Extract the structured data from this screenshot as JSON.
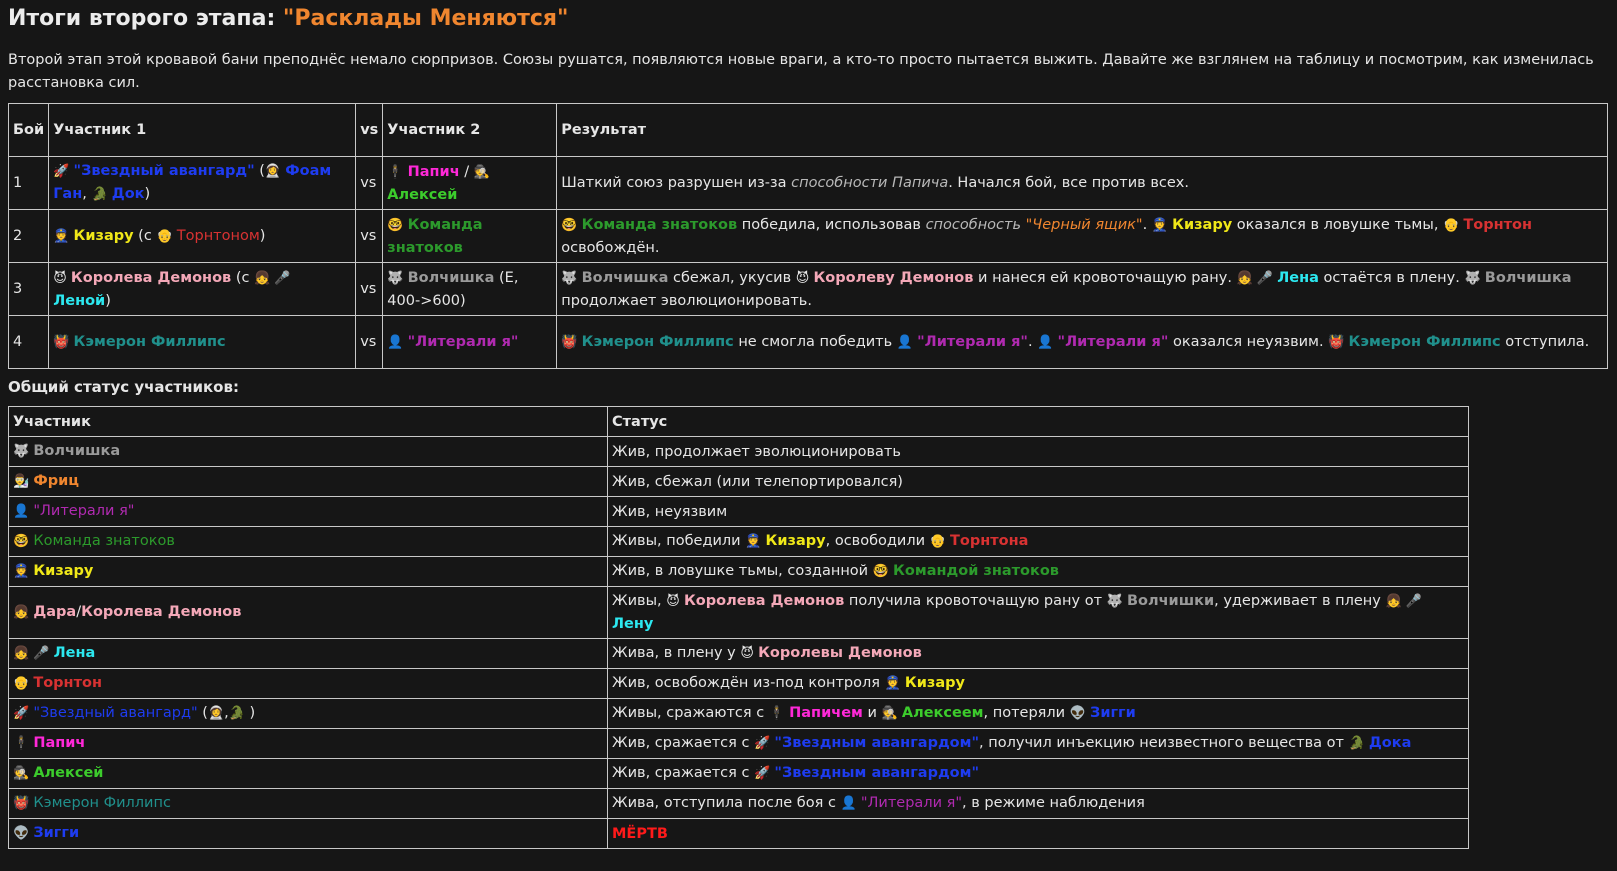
{
  "heading": {
    "prefix": "Итоги второго этапа: ",
    "accent": "\"Расклады Меняются\""
  },
  "intro": "Второй этап этой кровавой бани преподнёс немало сюрпризов. Союзы рушатся, появляются новые враги, а кто-то просто пытается выжить. Давайте же взглянем на таблицу и посмотрим, как изменилась расстановка сил.",
  "battles": {
    "headers": [
      "Бой",
      "Участник 1",
      "vs",
      "Участник 2",
      "Результат"
    ],
    "rows": [
      {
        "n": "1",
        "vs": "vs",
        "p1": [
          [
            "e",
            "🚀 "
          ],
          [
            "b blue",
            "\"Звездный авангард\""
          ],
          [
            "t",
            " ("
          ],
          [
            "e",
            "👩‍🚀 "
          ],
          [
            "b blue",
            "Фоам Ган"
          ],
          [
            "t",
            ", "
          ],
          [
            "e",
            "🐊 "
          ],
          [
            "b blue",
            "Док"
          ],
          [
            "t",
            ")"
          ]
        ],
        "p2": [
          [
            "e",
            "🕴 "
          ],
          [
            "b mag",
            "Папич"
          ],
          [
            "t",
            " / "
          ],
          [
            "e",
            "🕵 "
          ],
          [
            "b lime",
            "Алексей"
          ]
        ],
        "res": [
          [
            "t",
            "Шаткий союз разрушен из-за "
          ],
          [
            "i",
            "способности Папича"
          ],
          [
            "t",
            ". Начался бой, все против всех."
          ]
        ]
      },
      {
        "n": "2",
        "vs": "vs",
        "p1": [
          [
            "e",
            "👮 "
          ],
          [
            "b yel",
            "Кизару"
          ],
          [
            "t",
            " (с "
          ],
          [
            "e",
            "👴 "
          ],
          [
            "t red",
            "Торнтоном"
          ],
          [
            "t",
            ")"
          ]
        ],
        "p2": [
          [
            "e",
            "🤓 "
          ],
          [
            "b green",
            "Команда знатоков"
          ]
        ],
        "res": [
          [
            "e",
            "🤓 "
          ],
          [
            "b green",
            "Команда знатоков"
          ],
          [
            "t",
            " победила, использовав "
          ],
          [
            "i",
            "способность "
          ],
          [
            "oi",
            "\"Черный ящик\""
          ],
          [
            "t",
            ". "
          ],
          [
            "e",
            "👮 "
          ],
          [
            "b yel",
            "Кизару"
          ],
          [
            "t",
            " оказался в ловушке тьмы, "
          ],
          [
            "e",
            "👴 "
          ],
          [
            "b red",
            "Торнтон"
          ],
          [
            "t",
            " освобождён."
          ]
        ]
      },
      {
        "n": "3",
        "vs": "vs",
        "p1": [
          [
            "e",
            "😈 "
          ],
          [
            "b pink",
            "Королева Демонов"
          ],
          [
            "t",
            " (с "
          ],
          [
            "e",
            "👧 🎤 "
          ],
          [
            "b cyan",
            "Леной"
          ],
          [
            "t",
            ")"
          ]
        ],
        "p2": [
          [
            "e",
            "🐺 "
          ],
          [
            "b grey",
            "Волчишка"
          ],
          [
            "t",
            " (E, 400->600)"
          ]
        ],
        "res": [
          [
            "e",
            "🐺 "
          ],
          [
            "b grey",
            "Волчишка"
          ],
          [
            "t",
            " сбежал, укусив "
          ],
          [
            "e",
            "😈 "
          ],
          [
            "b pink",
            "Королеву Демонов"
          ],
          [
            "t",
            " и нанеся ей кровоточащую рану. "
          ],
          [
            "e",
            "👧 🎤 "
          ],
          [
            "b cyan",
            "Лена"
          ],
          [
            "t",
            " остаётся в плену. "
          ],
          [
            "e",
            "🐺 "
          ],
          [
            "b grey",
            "Волчишка"
          ],
          [
            "t",
            " продолжает эволюционировать."
          ]
        ]
      },
      {
        "n": "4",
        "vs": "vs",
        "p1": [
          [
            "e",
            "👹 "
          ],
          [
            "b teal",
            "Кэмерон Филлипс"
          ]
        ],
        "p2": [
          [
            "e",
            "👤 "
          ],
          [
            "b purp",
            "\"Литерали я\""
          ]
        ],
        "res": [
          [
            "e",
            "👹 "
          ],
          [
            "b teal",
            "Кэмерон Филлипс"
          ],
          [
            "t",
            " не смогла победить "
          ],
          [
            "e",
            "👤 "
          ],
          [
            "b purp",
            "\"Литерали я\""
          ],
          [
            "t",
            ". "
          ],
          [
            "e",
            "👤 "
          ],
          [
            "b purp",
            "\"Литерали я\""
          ],
          [
            "t",
            " оказался неуязвим. "
          ],
          [
            "e",
            "👹 "
          ],
          [
            "b teal",
            "Кэмерон Филлипс"
          ],
          [
            "t",
            " отступила."
          ]
        ]
      }
    ]
  },
  "status_heading": "Общий статус участников:",
  "status": {
    "headers": [
      "Участник",
      "Статус"
    ],
    "rows": [
      {
        "who": [
          [
            "e",
            "🐺 "
          ],
          [
            "b grey",
            "Волчишка"
          ]
        ],
        "st": [
          [
            "t",
            "Жив, продолжает эволюционировать"
          ]
        ]
      },
      {
        "who": [
          [
            "e",
            "👨‍🔬 "
          ],
          [
            "b orange",
            "Фриц"
          ]
        ],
        "st": [
          [
            "t",
            "Жив, сбежал (или телепортировался)"
          ]
        ]
      },
      {
        "who": [
          [
            "e",
            "👤 "
          ],
          [
            "t purp",
            "\"Литерали я\""
          ]
        ],
        "st": [
          [
            "t",
            "Жив, неуязвим"
          ]
        ]
      },
      {
        "who": [
          [
            "e",
            "🤓 "
          ],
          [
            "t green",
            "Команда знатоков"
          ]
        ],
        "st": [
          [
            "t",
            "Живы, победили "
          ],
          [
            "e",
            "👮 "
          ],
          [
            "b yel",
            "Кизару"
          ],
          [
            "t",
            ", освободили "
          ],
          [
            "e",
            "👴 "
          ],
          [
            "b red",
            "Торнтона"
          ]
        ]
      },
      {
        "who": [
          [
            "e",
            "👮 "
          ],
          [
            "b yel",
            "Кизару"
          ]
        ],
        "st": [
          [
            "t",
            "Жив, в ловушке тьмы, созданной "
          ],
          [
            "e",
            "🤓 "
          ],
          [
            "b green",
            "Командой знатоков"
          ]
        ]
      },
      {
        "who": [
          [
            "e",
            "👧 "
          ],
          [
            "b pink",
            "Дара"
          ],
          [
            "t",
            "/"
          ],
          [
            "b pink",
            "Королева Демонов"
          ]
        ],
        "st": [
          [
            "t",
            "Живы, "
          ],
          [
            "e",
            "😈 "
          ],
          [
            "b pink",
            "Королева Демонов"
          ],
          [
            "t",
            " получила кровоточащую рану от "
          ],
          [
            "e",
            "🐺 "
          ],
          [
            "b grey",
            "Волчишки"
          ],
          [
            "t",
            ", удерживает в плену "
          ],
          [
            "e",
            "👧 🎤 "
          ],
          [
            "b cyan",
            "Лену"
          ]
        ]
      },
      {
        "who": [
          [
            "e",
            "👧 🎤 "
          ],
          [
            "b cyan",
            "Лена"
          ]
        ],
        "st": [
          [
            "t",
            "Жива, в плену у "
          ],
          [
            "e",
            "😈 "
          ],
          [
            "b pink",
            "Королевы Демонов"
          ]
        ]
      },
      {
        "who": [
          [
            "e",
            "👴 "
          ],
          [
            "b red",
            "Торнтон"
          ]
        ],
        "st": [
          [
            "t",
            "Жив, освобождён из-под контроля "
          ],
          [
            "e",
            "👮 "
          ],
          [
            "b yel",
            "Кизару"
          ]
        ]
      },
      {
        "who": [
          [
            "e",
            "🚀 "
          ],
          [
            "t blue",
            "\"Звездный авангард\""
          ],
          [
            "t",
            " ("
          ],
          [
            "e",
            "👩‍🚀"
          ],
          [
            "t",
            ","
          ],
          [
            "e",
            "🐊"
          ],
          [
            "t",
            " )"
          ]
        ],
        "st": [
          [
            "t",
            "Живы, сражаются с "
          ],
          [
            "e",
            "🕴 "
          ],
          [
            "b mag",
            "Папичем"
          ],
          [
            "t",
            " и "
          ],
          [
            "e",
            "🕵 "
          ],
          [
            "b lime",
            "Алексеем"
          ],
          [
            "t",
            ", потеряли "
          ],
          [
            "e",
            "👽 "
          ],
          [
            "b blue",
            "Зигги"
          ]
        ]
      },
      {
        "who": [
          [
            "e",
            "🕴 "
          ],
          [
            "b mag",
            "Папич"
          ]
        ],
        "st": [
          [
            "t",
            "Жив, сражается с "
          ],
          [
            "e",
            "🚀 "
          ],
          [
            "b blue",
            "\"Звездным авангардом\""
          ],
          [
            "t",
            ", получил инъекцию неизвестного вещества от "
          ],
          [
            "e",
            "🐊 "
          ],
          [
            "b blue",
            "Дока"
          ]
        ]
      },
      {
        "who": [
          [
            "e",
            "🕵 "
          ],
          [
            "b lime",
            "Алексей"
          ]
        ],
        "st": [
          [
            "t",
            "Жив, сражается с "
          ],
          [
            "e",
            "🚀 "
          ],
          [
            "b blue",
            "\"Звездным авангардом\""
          ]
        ]
      },
      {
        "who": [
          [
            "e",
            "👹 "
          ],
          [
            "t teal",
            "Кэмерон Филлипс"
          ]
        ],
        "st": [
          [
            "t",
            "Жива, отступила после боя с "
          ],
          [
            "e",
            "👤 "
          ],
          [
            "t purp",
            "\"Литерали я\""
          ],
          [
            "t",
            ", в режиме наблюдения"
          ]
        ]
      },
      {
        "who": [
          [
            "e",
            "👽 "
          ],
          [
            "b blue",
            "Зигги"
          ]
        ],
        "st": [
          [
            "dead",
            "МЁРТВ"
          ]
        ]
      }
    ]
  }
}
